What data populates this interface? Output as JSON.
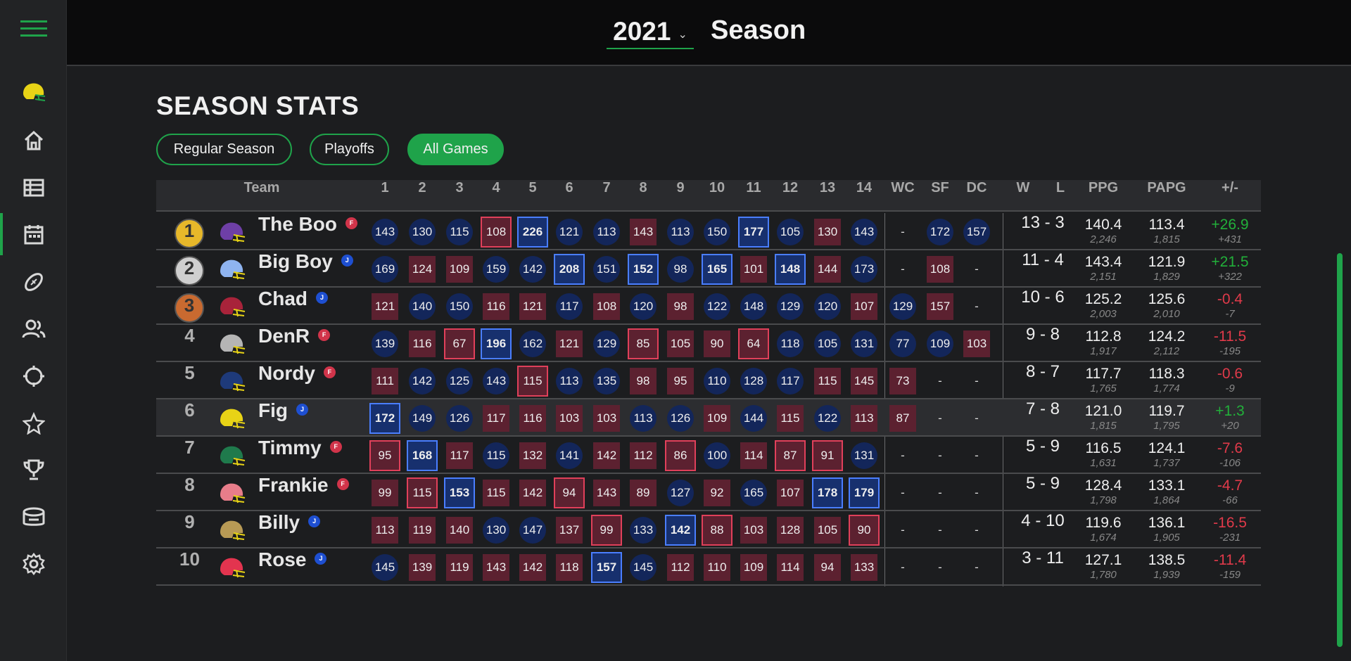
{
  "header": {
    "season_year": "2021",
    "season_label": "Season"
  },
  "page_title": "SEASON STATS",
  "tabs": [
    {
      "label": "Regular Season",
      "active": false
    },
    {
      "label": "Playoffs",
      "active": false
    },
    {
      "label": "All Games",
      "active": true
    }
  ],
  "sidebar": {
    "icons": [
      "menu-icon",
      "helmet-logo-icon",
      "home-icon",
      "table-icon",
      "calendar-icon",
      "football-icon",
      "people-icon",
      "target-icon",
      "star-icon",
      "trophy-icon",
      "stadium-icon",
      "settings-icon"
    ]
  },
  "table": {
    "headers": [
      "Team",
      "1",
      "2",
      "3",
      "4",
      "5",
      "6",
      "7",
      "8",
      "9",
      "10",
      "11",
      "12",
      "13",
      "14",
      "WC",
      "SF",
      "DC",
      "W",
      "L",
      "PPG",
      "PAPG",
      "+/-"
    ],
    "rows": [
      {
        "rank": "1",
        "medal": "gold",
        "name": "The Boo",
        "badge": "F",
        "helmet": "#6e3fa6",
        "scores": [
          [
            "143",
            "w"
          ],
          [
            "130",
            "w"
          ],
          [
            "115",
            "w"
          ],
          [
            "108",
            "lo"
          ],
          [
            "226",
            "hi"
          ],
          [
            "121",
            "w"
          ],
          [
            "113",
            "w"
          ],
          [
            "143",
            "l"
          ],
          [
            "113",
            "w"
          ],
          [
            "150",
            "w"
          ],
          [
            "177",
            "hi"
          ],
          [
            "105",
            "w"
          ],
          [
            "130",
            "l"
          ],
          [
            "143",
            "w"
          ]
        ],
        "wc": [
          "-",
          "na"
        ],
        "sf": [
          "172",
          "w"
        ],
        "dc": [
          "157",
          "w"
        ],
        "w": "13",
        "l": "3",
        "ppg": "140.4",
        "pts": "2,246",
        "papg": "113.4",
        "pa": "1,815",
        "diff": "+26.9",
        "diff_total": "+431"
      },
      {
        "rank": "2",
        "medal": "silver",
        "name": "Big Boy",
        "badge": "J",
        "helmet": "#8fb4f0",
        "scores": [
          [
            "169",
            "w"
          ],
          [
            "124",
            "l"
          ],
          [
            "109",
            "l"
          ],
          [
            "159",
            "w"
          ],
          [
            "142",
            "w"
          ],
          [
            "208",
            "hi"
          ],
          [
            "151",
            "w"
          ],
          [
            "152",
            "hi"
          ],
          [
            "98",
            "w"
          ],
          [
            "165",
            "hi"
          ],
          [
            "101",
            "l"
          ],
          [
            "148",
            "hi"
          ],
          [
            "144",
            "l"
          ],
          [
            "173",
            "w"
          ]
        ],
        "wc": [
          "-",
          "na"
        ],
        "sf": [
          "108",
          "l"
        ],
        "dc": [
          "-",
          "na"
        ],
        "w": "11",
        "l": "4",
        "ppg": "143.4",
        "pts": "2,151",
        "papg": "121.9",
        "pa": "1,829",
        "diff": "+21.5",
        "diff_total": "+322"
      },
      {
        "rank": "3",
        "medal": "bronze",
        "name": "Chad",
        "badge": "J",
        "helmet": "#a8233a",
        "scores": [
          [
            "121",
            "l"
          ],
          [
            "140",
            "w"
          ],
          [
            "150",
            "w"
          ],
          [
            "116",
            "l"
          ],
          [
            "121",
            "l"
          ],
          [
            "117",
            "w"
          ],
          [
            "108",
            "l"
          ],
          [
            "120",
            "w"
          ],
          [
            "98",
            "l"
          ],
          [
            "122",
            "w"
          ],
          [
            "148",
            "w"
          ],
          [
            "129",
            "w"
          ],
          [
            "120",
            "w"
          ],
          [
            "107",
            "l"
          ]
        ],
        "wc": [
          "129",
          "w"
        ],
        "sf": [
          "157",
          "l"
        ],
        "dc": [
          "-",
          "na"
        ],
        "w": "10",
        "l": "6",
        "ppg": "125.2",
        "pts": "2,003",
        "papg": "125.6",
        "pa": "2,010",
        "diff": "-0.4",
        "diff_total": "-7"
      },
      {
        "rank": "4",
        "medal": "",
        "name": "DenR",
        "badge": "F",
        "helmet": "#b5b5b5",
        "scores": [
          [
            "139",
            "w"
          ],
          [
            "116",
            "l"
          ],
          [
            "67",
            "lo"
          ],
          [
            "196",
            "hi"
          ],
          [
            "162",
            "w"
          ],
          [
            "121",
            "l"
          ],
          [
            "129",
            "w"
          ],
          [
            "85",
            "lo"
          ],
          [
            "105",
            "l"
          ],
          [
            "90",
            "l"
          ],
          [
            "64",
            "lo"
          ],
          [
            "118",
            "w"
          ],
          [
            "105",
            "w"
          ],
          [
            "131",
            "w"
          ]
        ],
        "wc": [
          "77",
          "w"
        ],
        "sf": [
          "109",
          "w"
        ],
        "dc": [
          "103",
          "l"
        ],
        "w": "9",
        "l": "8",
        "ppg": "112.8",
        "pts": "1,917",
        "papg": "124.2",
        "pa": "2,112",
        "diff": "-11.5",
        "diff_total": "-195"
      },
      {
        "rank": "5",
        "medal": "",
        "name": "Nordy",
        "badge": "F",
        "helmet": "#1e3a7a",
        "scores": [
          [
            "111",
            "l"
          ],
          [
            "142",
            "w"
          ],
          [
            "125",
            "w"
          ],
          [
            "143",
            "w"
          ],
          [
            "115",
            "lo"
          ],
          [
            "113",
            "w"
          ],
          [
            "135",
            "w"
          ],
          [
            "98",
            "l"
          ],
          [
            "95",
            "l"
          ],
          [
            "110",
            "w"
          ],
          [
            "128",
            "w"
          ],
          [
            "117",
            "w"
          ],
          [
            "115",
            "l"
          ],
          [
            "145",
            "l"
          ]
        ],
        "wc": [
          "73",
          "l"
        ],
        "sf": [
          "-",
          "na"
        ],
        "dc": [
          "-",
          "na"
        ],
        "w": "8",
        "l": "7",
        "ppg": "117.7",
        "pts": "1,765",
        "papg": "118.3",
        "pa": "1,774",
        "diff": "-0.6",
        "diff_total": "-9"
      },
      {
        "rank": "6",
        "medal": "",
        "name": "Fig",
        "badge": "J",
        "helmet": "#e8d316",
        "scores": [
          [
            "172",
            "hi"
          ],
          [
            "149",
            "w"
          ],
          [
            "126",
            "w"
          ],
          [
            "117",
            "l"
          ],
          [
            "116",
            "l"
          ],
          [
            "103",
            "l"
          ],
          [
            "103",
            "l"
          ],
          [
            "113",
            "w"
          ],
          [
            "126",
            "w"
          ],
          [
            "109",
            "l"
          ],
          [
            "144",
            "w"
          ],
          [
            "115",
            "l"
          ],
          [
            "122",
            "w"
          ],
          [
            "113",
            "l"
          ]
        ],
        "wc": [
          "87",
          "l"
        ],
        "sf": [
          "-",
          "na"
        ],
        "dc": [
          "-",
          "na"
        ],
        "w": "7",
        "l": "8",
        "ppg": "121.0",
        "pts": "1,815",
        "papg": "119.7",
        "pa": "1,795",
        "diff": "+1.3",
        "diff_total": "+20"
      },
      {
        "rank": "7",
        "medal": "",
        "name": "Timmy",
        "badge": "F",
        "helmet": "#1f7a4c",
        "scores": [
          [
            "95",
            "lo"
          ],
          [
            "168",
            "hi"
          ],
          [
            "117",
            "l"
          ],
          [
            "115",
            "w"
          ],
          [
            "132",
            "l"
          ],
          [
            "141",
            "w"
          ],
          [
            "142",
            "l"
          ],
          [
            "112",
            "l"
          ],
          [
            "86",
            "lo"
          ],
          [
            "100",
            "w"
          ],
          [
            "114",
            "l"
          ],
          [
            "87",
            "lo"
          ],
          [
            "91",
            "lo"
          ],
          [
            "131",
            "w"
          ]
        ],
        "wc": [
          "-",
          "na"
        ],
        "sf": [
          "-",
          "na"
        ],
        "dc": [
          "-",
          "na"
        ],
        "w": "5",
        "l": "9",
        "ppg": "116.5",
        "pts": "1,631",
        "papg": "124.1",
        "pa": "1,737",
        "diff": "-7.6",
        "diff_total": "-106"
      },
      {
        "rank": "8",
        "medal": "",
        "name": "Frankie",
        "badge": "F",
        "helmet": "#e87d8a",
        "scores": [
          [
            "99",
            "l"
          ],
          [
            "115",
            "lo"
          ],
          [
            "153",
            "hi"
          ],
          [
            "115",
            "l"
          ],
          [
            "142",
            "l"
          ],
          [
            "94",
            "lo"
          ],
          [
            "143",
            "l"
          ],
          [
            "89",
            "l"
          ],
          [
            "127",
            "w"
          ],
          [
            "92",
            "l"
          ],
          [
            "165",
            "w"
          ],
          [
            "107",
            "l"
          ],
          [
            "178",
            "hi"
          ],
          [
            "179",
            "hi"
          ]
        ],
        "wc": [
          "-",
          "na"
        ],
        "sf": [
          "-",
          "na"
        ],
        "dc": [
          "-",
          "na"
        ],
        "w": "5",
        "l": "9",
        "ppg": "128.4",
        "pts": "1,798",
        "papg": "133.1",
        "pa": "1,864",
        "diff": "-4.7",
        "diff_total": "-66"
      },
      {
        "rank": "9",
        "medal": "",
        "name": "Billy",
        "badge": "J",
        "helmet": "#b89a55",
        "scores": [
          [
            "113",
            "l"
          ],
          [
            "119",
            "l"
          ],
          [
            "140",
            "l"
          ],
          [
            "130",
            "w"
          ],
          [
            "147",
            "w"
          ],
          [
            "137",
            "l"
          ],
          [
            "99",
            "lo"
          ],
          [
            "133",
            "w"
          ],
          [
            "142",
            "hi"
          ],
          [
            "88",
            "lo"
          ],
          [
            "103",
            "l"
          ],
          [
            "128",
            "l"
          ],
          [
            "105",
            "l"
          ],
          [
            "90",
            "lo"
          ]
        ],
        "wc": [
          "-",
          "na"
        ],
        "sf": [
          "-",
          "na"
        ],
        "dc": [
          "-",
          "na"
        ],
        "w": "4",
        "l": "10",
        "ppg": "119.6",
        "pts": "1,674",
        "papg": "136.1",
        "pa": "1,905",
        "diff": "-16.5",
        "diff_total": "-231"
      },
      {
        "rank": "10",
        "medal": "",
        "name": "Rose",
        "badge": "J",
        "helmet": "#e3344f",
        "scores": [
          [
            "145",
            "w"
          ],
          [
            "139",
            "l"
          ],
          [
            "119",
            "l"
          ],
          [
            "143",
            "l"
          ],
          [
            "142",
            "l"
          ],
          [
            "118",
            "l"
          ],
          [
            "157",
            "hi"
          ],
          [
            "145",
            "w"
          ],
          [
            "112",
            "l"
          ],
          [
            "110",
            "l"
          ],
          [
            "109",
            "l"
          ],
          [
            "114",
            "l"
          ],
          [
            "94",
            "l"
          ],
          [
            "133",
            "l"
          ]
        ],
        "wc": [
          "-",
          "na"
        ],
        "sf": [
          "-",
          "na"
        ],
        "dc": [
          "-",
          "na"
        ],
        "w": "3",
        "l": "11",
        "ppg": "127.1",
        "pts": "1,780",
        "papg": "138.5",
        "pa": "1,939",
        "diff": "-11.4",
        "diff_total": "-159"
      }
    ]
  },
  "colors": {
    "accent": "#1fa34a",
    "win": "#13265a",
    "loss": "#5c2130",
    "positive": "#22b03a",
    "negative": "#e03a4a",
    "gold": "#e7b82a",
    "silver": "#cfcfcf",
    "bronze": "#c96a30",
    "badge_F": "#d1344a",
    "badge_J": "#1e4fd1"
  }
}
